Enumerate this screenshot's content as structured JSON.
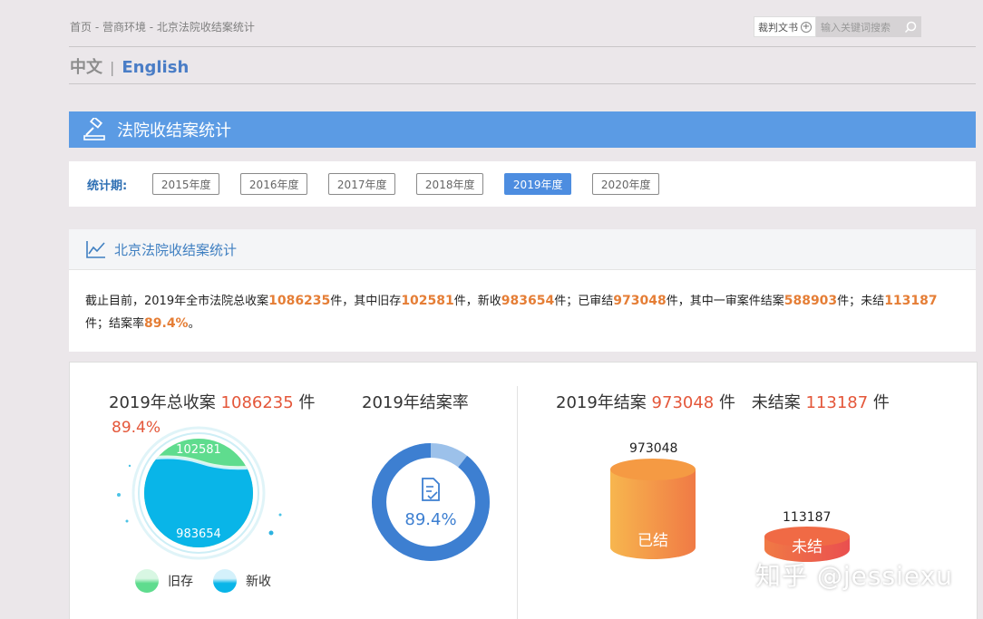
{
  "header": {
    "breadcrumb": "首页 - 营商环境 - 北京法院收结案统计",
    "judgment_docs_label": "裁判文书",
    "search_placeholder": "输入关键词搜索",
    "lang_zh": "中文",
    "lang_sep": "|",
    "lang_en": "English"
  },
  "title_bar": {
    "title": "法院收结案统计"
  },
  "period": {
    "label": "统计期:",
    "years": [
      "2015年度",
      "2016年度",
      "2017年度",
      "2018年度",
      "2019年度",
      "2020年度"
    ],
    "active": "2019年度"
  },
  "stats": {
    "heading": "北京法院收结案统计",
    "s1": "截止目前，2019年全市法院总收案",
    "v_total": "1086235",
    "s2": "件，其中旧存",
    "v_old": "102581",
    "s3": "件，新收",
    "v_new": "983654",
    "s4": "件；已审结",
    "v_closed": "973048",
    "s5": "件，其中一审案件结案",
    "v_first": "588903",
    "s6": "件；未结",
    "v_open": "113187",
    "s7": "件；结案率",
    "v_rate": "89.4%",
    "s8": "。"
  },
  "chart1": {
    "title_prefix": "2019年总收案",
    "total": "1086235",
    "unit": "件",
    "rate": "89.4%",
    "old_value": "102581",
    "new_value": "983654",
    "legend_old": "旧存",
    "legend_new": "新收",
    "color_old": "#5fdc8e",
    "color_new": "#09b5e8"
  },
  "chart2": {
    "title": "2019年结案率",
    "rate_label": "89.4%",
    "rate": 0.894,
    "color_fill": "#3d7fd1",
    "color_rest": "#9cc1ea"
  },
  "chart3": {
    "title_prefix1": "2019年结案",
    "closed": "973048",
    "unit": "件",
    "title_prefix2": "未结案",
    "open": "113187",
    "closed_label": "已结",
    "open_label": "未结",
    "closed_top_label": "973048",
    "open_top_label": "113187"
  },
  "watermark": "知乎 @jessiexu"
}
